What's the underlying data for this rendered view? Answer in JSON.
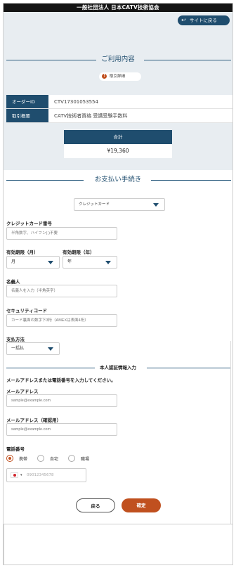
{
  "header": {
    "org_name": "一般社団法人 日本CATV技術協会"
  },
  "top": {
    "back_to_site": "サイトに戻る"
  },
  "usage": {
    "section_title": "ご利用内容",
    "detail_button": "取引詳細",
    "order_id_label": "オーダーID",
    "order_id_value": "CTV17301053554",
    "summary_label": "取引概要",
    "summary_value": "CATV技術者資格 受講受験手数料",
    "total_label": "合計",
    "total_value": "¥19,360"
  },
  "payment": {
    "section_title": "お支払い手続き",
    "method_select": "クレジットカード",
    "card_number_label": "クレジットカード番号",
    "card_number_placeholder": "半角数字、ハイフン(-)不要",
    "expiry_month_label": "有効期限（月）",
    "expiry_month_value": "月",
    "expiry_year_label": "有効期限（年）",
    "expiry_year_value": "年",
    "name_label": "名義人",
    "name_placeholder": "名義人を入力（半角英字）",
    "security_label": "セキュリティコード",
    "security_placeholder": "カード裏面の数字下3桁（AMEXは表面4桁）",
    "method_label": "支払方法",
    "method_value": "一括払"
  },
  "auth": {
    "section_title": "本人認証情報入力",
    "note": "メールアドレスまたは電話番号を入力してください。",
    "email_label": "メールアドレス",
    "email_placeholder": "sample@example.com",
    "email_confirm_label": "メールアドレス（確認用）",
    "email_confirm_placeholder": "sample@example.com",
    "phone_label": "電話番号",
    "phone_types": [
      "携帯",
      "自宅",
      "職場"
    ],
    "phone_selected": "携帯",
    "phone_placeholder": "09012345678",
    "flag_icon": "japan-flag-icon"
  },
  "actions": {
    "back": "戻る",
    "confirm": "確定"
  },
  "colors": {
    "primary": "#1f4d6e",
    "accent": "#c0501f",
    "band": "#e8edf1"
  }
}
